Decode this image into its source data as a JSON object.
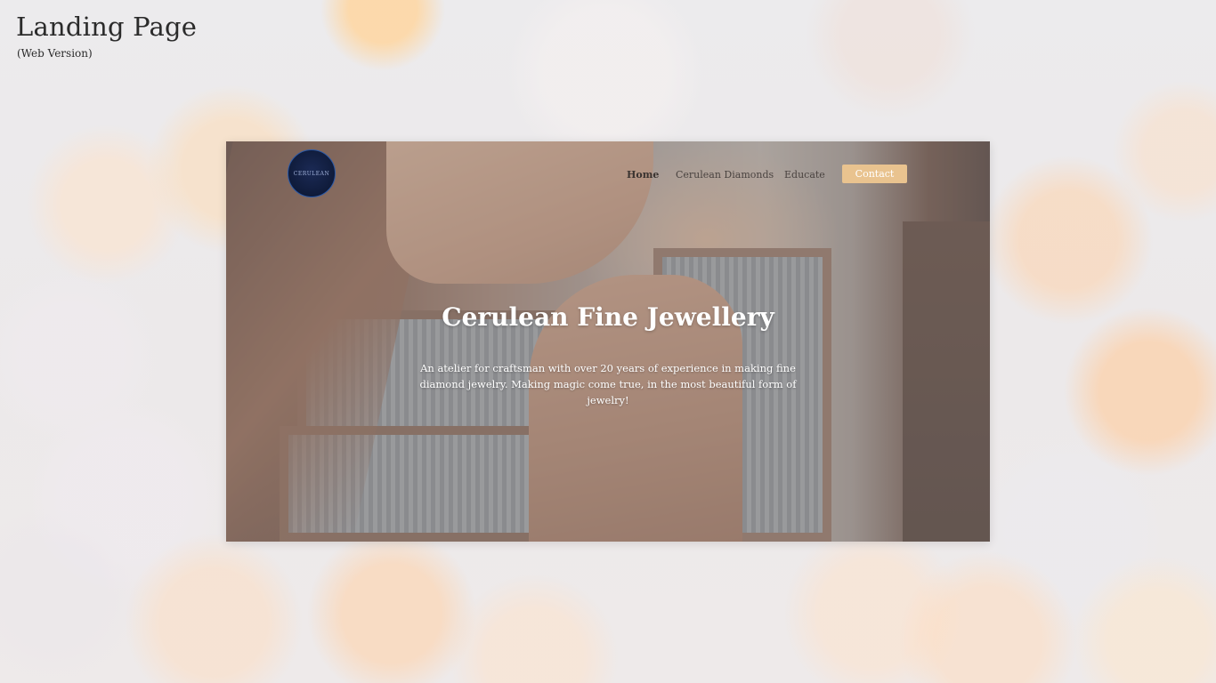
{
  "page": {
    "title": "Landing Page",
    "subtitle": "(Web Version)"
  },
  "site": {
    "logo_text": "CERULEAN",
    "nav": {
      "home": "Home",
      "diamonds": "Cerulean Diamonds",
      "educate": "Educate",
      "contact": "Contact"
    },
    "hero": {
      "title": "Cerulean Fine Jewellery",
      "description": "An atelier for craftsman with over 20 years of experience in making fine diamond jewelry. Making magic come true, in the most beautiful form of jewelry!"
    }
  },
  "colors": {
    "accent": "#e9c38f",
    "logo_bg": "#0f1b3a",
    "text_dark": "#2b2b2b"
  }
}
